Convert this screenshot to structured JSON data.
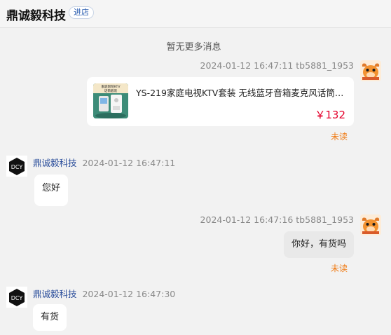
{
  "header": {
    "shop_name": "鼎诚毅科技",
    "enter_shop": "进店"
  },
  "no_more": "暂无更多消息",
  "messages": [
    {
      "meta": "2024-01-12 16:47:11   tb5881_1953"
    },
    {
      "sender": "鼎诚毅科技",
      "time": "2024-01-12 16:47:11",
      "text": "您好"
    },
    {
      "meta": "2024-01-12 16:47:16   tb5881_1953",
      "text": "你好，有货吗",
      "status": "未读"
    },
    {
      "sender": "鼎诚毅科技",
      "time": "2024-01-12 16:47:30",
      "text": "有货"
    }
  ],
  "product_card": {
    "title": "YS-219家庭电视KTV套装 无线蓝牙音箱麦克风话筒音响...",
    "price": "￥132",
    "thumb_text": "家庭影院KTV 话筒套装",
    "status": "未读"
  },
  "colors": {
    "unread": "#f07b14",
    "price": "#e4002b",
    "sender_name": "#2a4d9b"
  }
}
